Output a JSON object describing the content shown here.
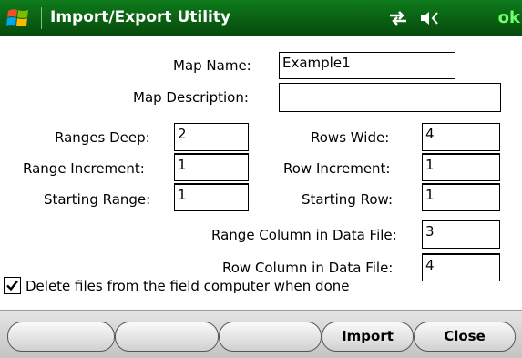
{
  "titlebar": {
    "title": "Import/Export Utility",
    "ok_label": "ok",
    "icons": [
      "windows-start-icon",
      "connectivity-icon",
      "volume-icon"
    ]
  },
  "form": {
    "map_name_label": "Map Name:",
    "map_name_value": "Example1",
    "map_description_label": "Map Description:",
    "map_description_value": "",
    "ranges_deep_label": "Ranges Deep:",
    "ranges_deep_value": "2",
    "rows_wide_label": "Rows Wide:",
    "rows_wide_value": "4",
    "range_increment_label": "Range Increment:",
    "range_increment_value": "1",
    "row_increment_label": "Row Increment:",
    "row_increment_value": "1",
    "starting_range_label": "Starting Range:",
    "starting_range_value": "1",
    "starting_row_label": "Starting Row:",
    "starting_row_value": "1",
    "range_column_label": "Range Column in Data File:",
    "range_column_value": "3",
    "row_column_label": "Row Column in Data File:",
    "row_column_value": "4",
    "delete_files_label": "Delete files from the field computer when done",
    "delete_files_checked": true
  },
  "softkeys": {
    "import_label": "Import",
    "close_label": "Close"
  },
  "colors": {
    "titlebar": "#0a5f12",
    "ok": "#6dff6d"
  }
}
